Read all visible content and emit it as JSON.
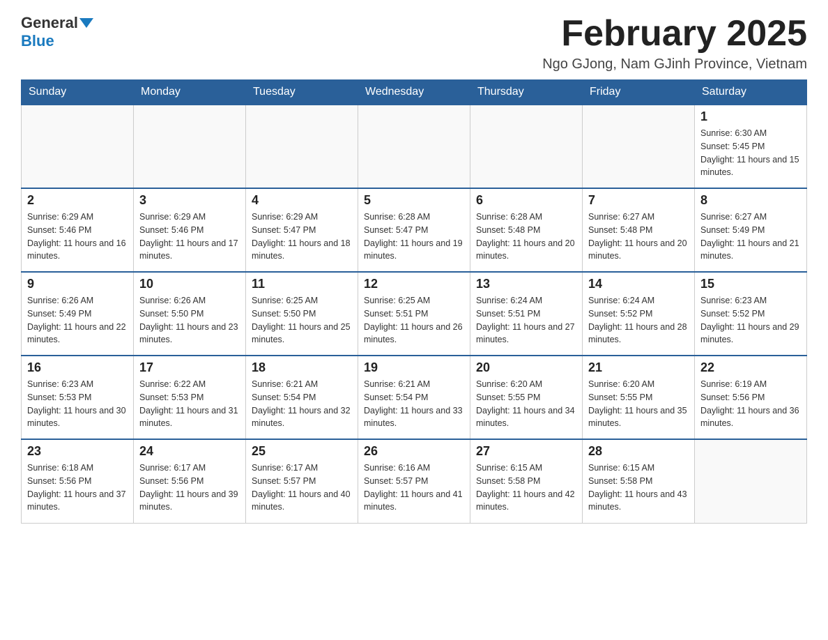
{
  "header": {
    "logo": {
      "general": "General",
      "blue": "Blue"
    },
    "title": "February 2025",
    "location": "Ngo GJong, Nam GJinh Province, Vietnam"
  },
  "days_of_week": [
    "Sunday",
    "Monday",
    "Tuesday",
    "Wednesday",
    "Thursday",
    "Friday",
    "Saturday"
  ],
  "weeks": [
    [
      {
        "day": "",
        "info": ""
      },
      {
        "day": "",
        "info": ""
      },
      {
        "day": "",
        "info": ""
      },
      {
        "day": "",
        "info": ""
      },
      {
        "day": "",
        "info": ""
      },
      {
        "day": "",
        "info": ""
      },
      {
        "day": "1",
        "info": "Sunrise: 6:30 AM\nSunset: 5:45 PM\nDaylight: 11 hours and 15 minutes."
      }
    ],
    [
      {
        "day": "2",
        "info": "Sunrise: 6:29 AM\nSunset: 5:46 PM\nDaylight: 11 hours and 16 minutes."
      },
      {
        "day": "3",
        "info": "Sunrise: 6:29 AM\nSunset: 5:46 PM\nDaylight: 11 hours and 17 minutes."
      },
      {
        "day": "4",
        "info": "Sunrise: 6:29 AM\nSunset: 5:47 PM\nDaylight: 11 hours and 18 minutes."
      },
      {
        "day": "5",
        "info": "Sunrise: 6:28 AM\nSunset: 5:47 PM\nDaylight: 11 hours and 19 minutes."
      },
      {
        "day": "6",
        "info": "Sunrise: 6:28 AM\nSunset: 5:48 PM\nDaylight: 11 hours and 20 minutes."
      },
      {
        "day": "7",
        "info": "Sunrise: 6:27 AM\nSunset: 5:48 PM\nDaylight: 11 hours and 20 minutes."
      },
      {
        "day": "8",
        "info": "Sunrise: 6:27 AM\nSunset: 5:49 PM\nDaylight: 11 hours and 21 minutes."
      }
    ],
    [
      {
        "day": "9",
        "info": "Sunrise: 6:26 AM\nSunset: 5:49 PM\nDaylight: 11 hours and 22 minutes."
      },
      {
        "day": "10",
        "info": "Sunrise: 6:26 AM\nSunset: 5:50 PM\nDaylight: 11 hours and 23 minutes."
      },
      {
        "day": "11",
        "info": "Sunrise: 6:25 AM\nSunset: 5:50 PM\nDaylight: 11 hours and 25 minutes."
      },
      {
        "day": "12",
        "info": "Sunrise: 6:25 AM\nSunset: 5:51 PM\nDaylight: 11 hours and 26 minutes."
      },
      {
        "day": "13",
        "info": "Sunrise: 6:24 AM\nSunset: 5:51 PM\nDaylight: 11 hours and 27 minutes."
      },
      {
        "day": "14",
        "info": "Sunrise: 6:24 AM\nSunset: 5:52 PM\nDaylight: 11 hours and 28 minutes."
      },
      {
        "day": "15",
        "info": "Sunrise: 6:23 AM\nSunset: 5:52 PM\nDaylight: 11 hours and 29 minutes."
      }
    ],
    [
      {
        "day": "16",
        "info": "Sunrise: 6:23 AM\nSunset: 5:53 PM\nDaylight: 11 hours and 30 minutes."
      },
      {
        "day": "17",
        "info": "Sunrise: 6:22 AM\nSunset: 5:53 PM\nDaylight: 11 hours and 31 minutes."
      },
      {
        "day": "18",
        "info": "Sunrise: 6:21 AM\nSunset: 5:54 PM\nDaylight: 11 hours and 32 minutes."
      },
      {
        "day": "19",
        "info": "Sunrise: 6:21 AM\nSunset: 5:54 PM\nDaylight: 11 hours and 33 minutes."
      },
      {
        "day": "20",
        "info": "Sunrise: 6:20 AM\nSunset: 5:55 PM\nDaylight: 11 hours and 34 minutes."
      },
      {
        "day": "21",
        "info": "Sunrise: 6:20 AM\nSunset: 5:55 PM\nDaylight: 11 hours and 35 minutes."
      },
      {
        "day": "22",
        "info": "Sunrise: 6:19 AM\nSunset: 5:56 PM\nDaylight: 11 hours and 36 minutes."
      }
    ],
    [
      {
        "day": "23",
        "info": "Sunrise: 6:18 AM\nSunset: 5:56 PM\nDaylight: 11 hours and 37 minutes."
      },
      {
        "day": "24",
        "info": "Sunrise: 6:17 AM\nSunset: 5:56 PM\nDaylight: 11 hours and 39 minutes."
      },
      {
        "day": "25",
        "info": "Sunrise: 6:17 AM\nSunset: 5:57 PM\nDaylight: 11 hours and 40 minutes."
      },
      {
        "day": "26",
        "info": "Sunrise: 6:16 AM\nSunset: 5:57 PM\nDaylight: 11 hours and 41 minutes."
      },
      {
        "day": "27",
        "info": "Sunrise: 6:15 AM\nSunset: 5:58 PM\nDaylight: 11 hours and 42 minutes."
      },
      {
        "day": "28",
        "info": "Sunrise: 6:15 AM\nSunset: 5:58 PM\nDaylight: 11 hours and 43 minutes."
      },
      {
        "day": "",
        "info": ""
      }
    ]
  ]
}
